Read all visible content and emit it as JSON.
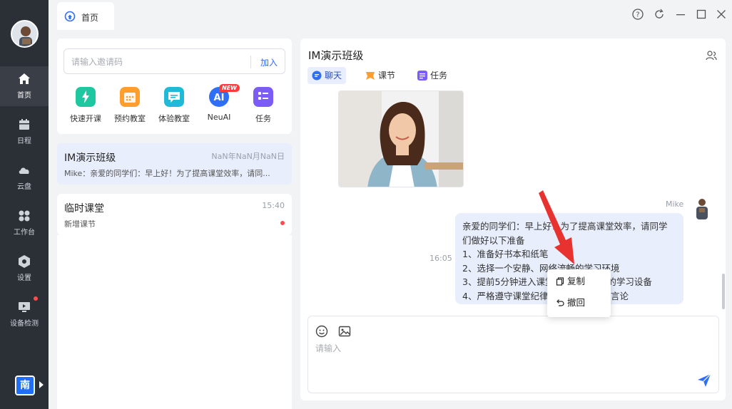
{
  "sidebar": {
    "items": [
      {
        "label": "首页",
        "icon": "home-icon"
      },
      {
        "label": "日程",
        "icon": "calendar-icon"
      },
      {
        "label": "云盘",
        "icon": "cloud-icon"
      },
      {
        "label": "工作台",
        "icon": "apps-icon"
      },
      {
        "label": "设置",
        "icon": "settings-icon"
      },
      {
        "label": "设备检测",
        "icon": "monitor-icon"
      }
    ],
    "user_initial": "南"
  },
  "topbar": {
    "tab_label": "首页"
  },
  "invite": {
    "placeholder": "请输入邀请码",
    "join_label": "加入"
  },
  "quick_actions": [
    {
      "label": "快速开课",
      "color": "#1fc7a0"
    },
    {
      "label": "预约教室",
      "color": "#ff9d2e"
    },
    {
      "label": "体验教室",
      "color": "#21b9d8"
    },
    {
      "label": "NeuAI",
      "color": "#2f6ef7",
      "badge": "NEW"
    },
    {
      "label": "任务",
      "color": "#7b5cf5"
    }
  ],
  "conversations": [
    {
      "name": "IM演示班级",
      "time": "NaN年NaN月NaN日",
      "preview": "Mike：亲爱的同学们：早上好！为了提高课堂效率，请同..."
    },
    {
      "name": "临时课堂",
      "time": "15:40",
      "preview": "新增课节"
    }
  ],
  "chat": {
    "title": "IM演示班级",
    "tabs": [
      {
        "label": "聊天",
        "color": "#2f6ef7"
      },
      {
        "label": "课节",
        "color": "#ff9d2e"
      },
      {
        "label": "任务",
        "color": "#7b5cf5"
      }
    ],
    "sender": "Mike",
    "message_time": "16:05",
    "message_lines": [
      "亲爱的同学们：早上好！为了提高课堂效率，请同学",
      "们做好以下准备",
      "1、准备好书本和纸笔",
      "2、选择一个安静、网络流畅的学习环境",
      "3、提前5分钟进入课堂，准备好相关的学习设备",
      "4、严格遵守课堂纪律，不发表无关的言论"
    ],
    "input_placeholder": "请输入"
  },
  "context_menu": {
    "copy_label": "复制",
    "recall_label": "撤回"
  },
  "colors": {
    "accent": "#2f6ef7",
    "sidebar_bg": "#2b2f36",
    "active_bg": "#e8eefc",
    "arrow": "#e8322f"
  }
}
